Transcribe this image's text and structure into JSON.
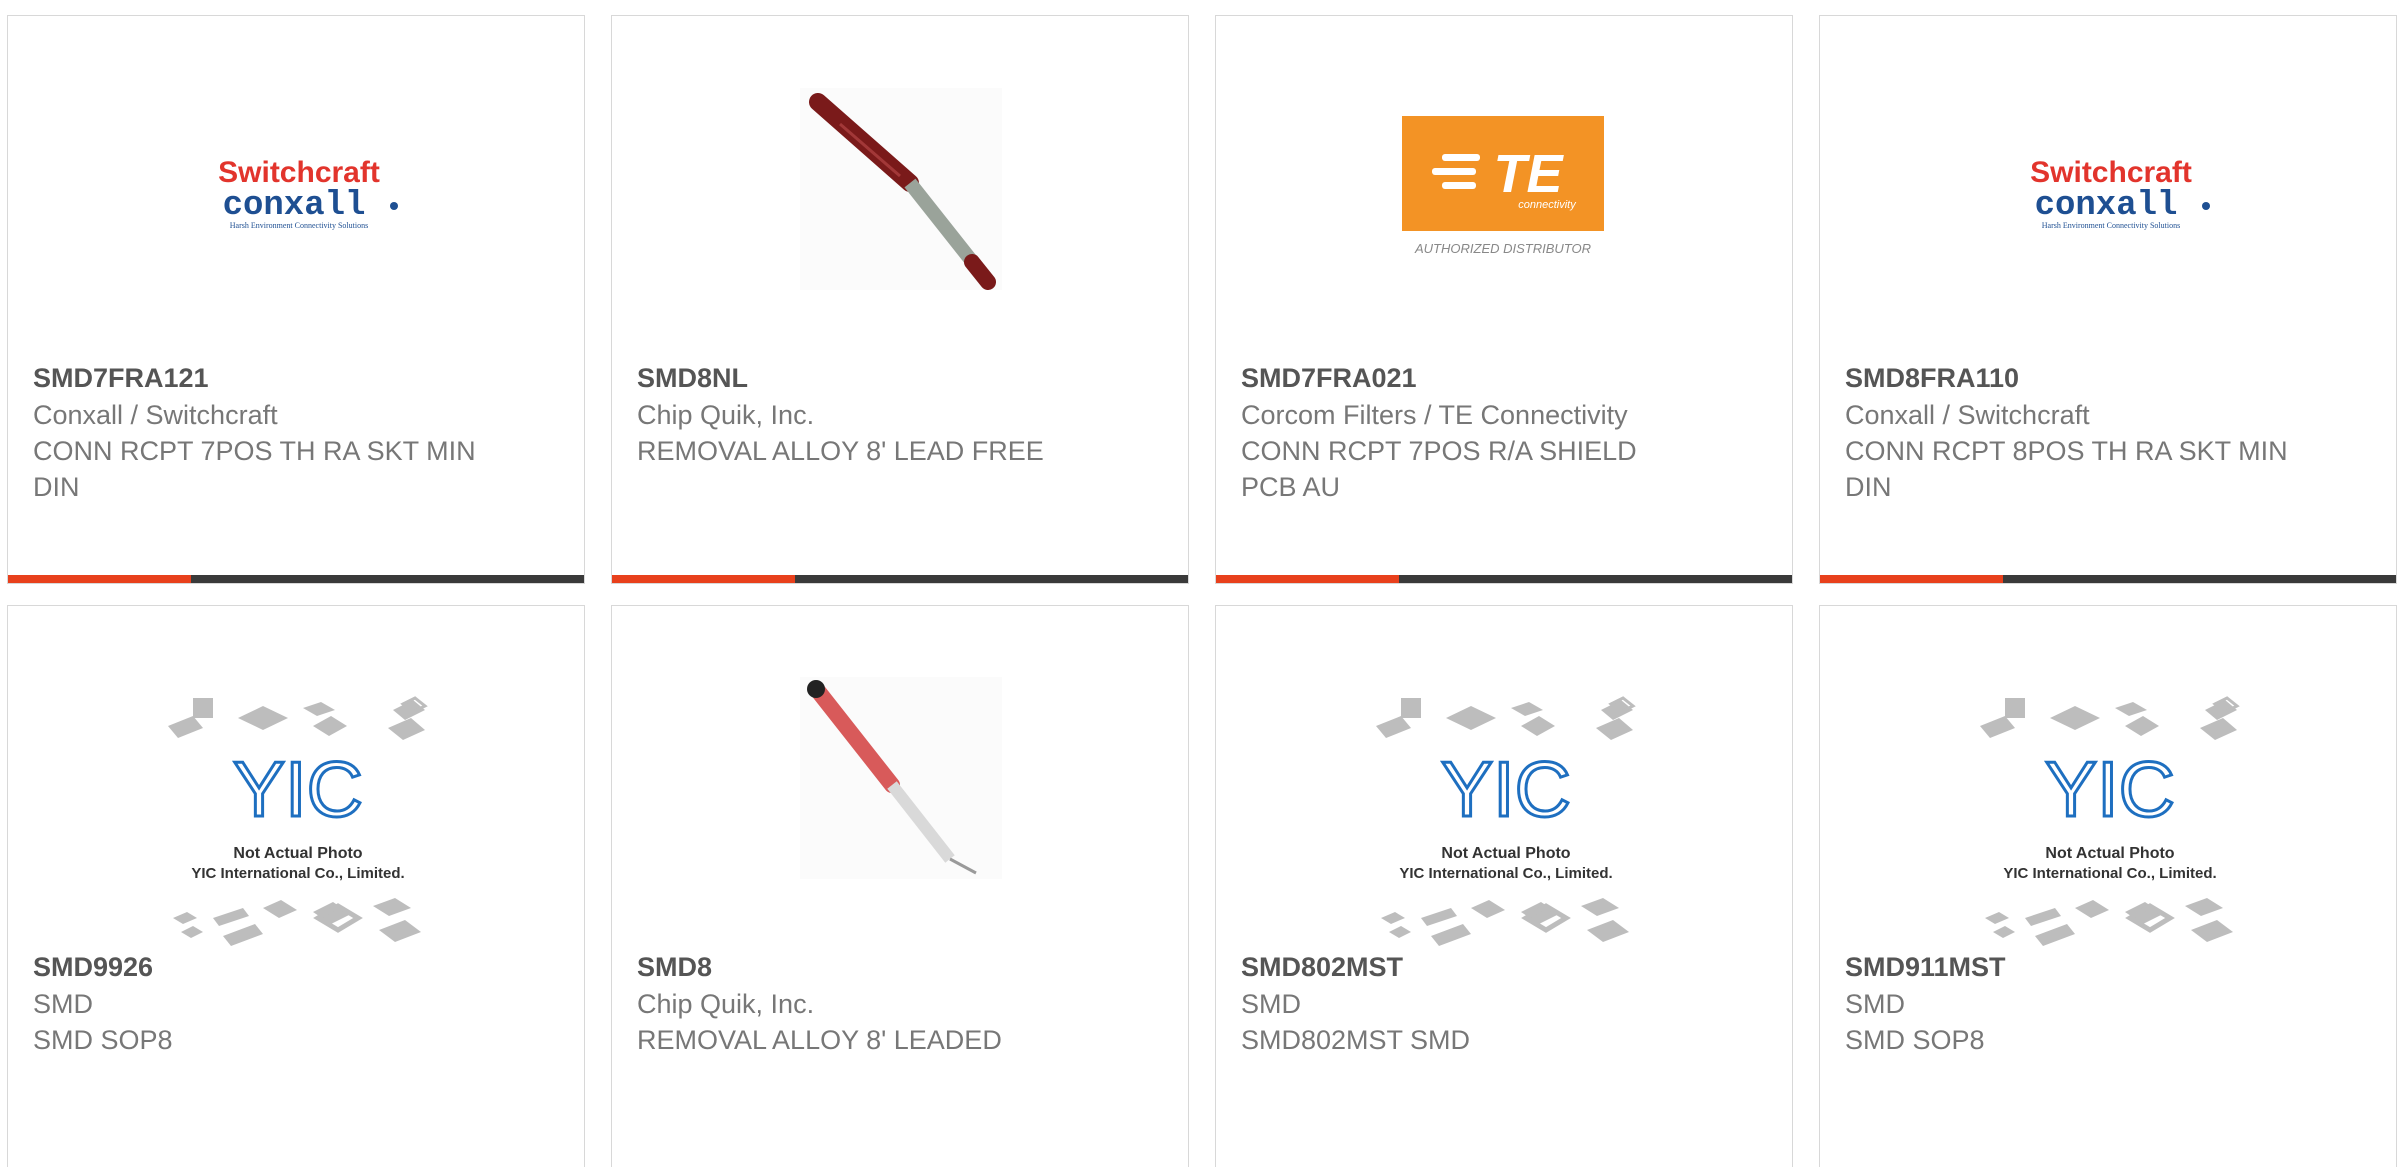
{
  "colors": {
    "accent": "#e8401c",
    "bar_dark": "#3a3a3a",
    "border": "#d8d8d8",
    "te_orange": "#f39325",
    "switchcraft_red": "#e2342c",
    "conxall_blue": "#1e4f92",
    "yic_blue": "#1e6fc0"
  },
  "logos": {
    "switchcraft": {
      "line1": "Switchcraft",
      "line2": "conxall",
      "tagline": "Harsh Environment Connectivity Solutions"
    },
    "te": {
      "mark": "TE",
      "sub": "connectivity",
      "caption": "AUTHORIZED DISTRIBUTOR"
    },
    "yic": {
      "mark": "YIC",
      "line1": "Not Actual Photo",
      "line2": "YIC International Co., Limited."
    }
  },
  "products": [
    {
      "part": "SMD7FRA121",
      "manufacturer": "Conxall / Switchcraft",
      "description": "CONN RCPT 7POS TH RA SKT MIN DIN",
      "image": "switchcraft-conxall-logo"
    },
    {
      "part": "SMD8NL",
      "manufacturer": "Chip Quik, Inc.",
      "description": "REMOVAL ALLOY 8' LEAD FREE",
      "image": "removal-alloy-stick-dark"
    },
    {
      "part": "SMD7FRA021",
      "manufacturer": "Corcom Filters / TE Connectivity",
      "description": "CONN RCPT 7POS R/A SHIELD PCB AU",
      "image": "te-connectivity-logo"
    },
    {
      "part": "SMD8FRA110",
      "manufacturer": "Conxall / Switchcraft",
      "description": "CONN RCPT 8POS TH RA SKT MIN DIN",
      "image": "switchcraft-conxall-logo"
    },
    {
      "part": "SMD9926",
      "manufacturer": "SMD",
      "description": "SMD SOP8",
      "image": "yic-not-actual-photo"
    },
    {
      "part": "SMD8",
      "manufacturer": "Chip Quik, Inc.",
      "description": "REMOVAL ALLOY 8' LEADED",
      "image": "removal-alloy-stick-red"
    },
    {
      "part": "SMD802MST",
      "manufacturer": "SMD",
      "description": "SMD802MST SMD",
      "image": "yic-not-actual-photo"
    },
    {
      "part": "SMD911MST",
      "manufacturer": "SMD",
      "description": "SMD SOP8",
      "image": "yic-not-actual-photo"
    }
  ]
}
